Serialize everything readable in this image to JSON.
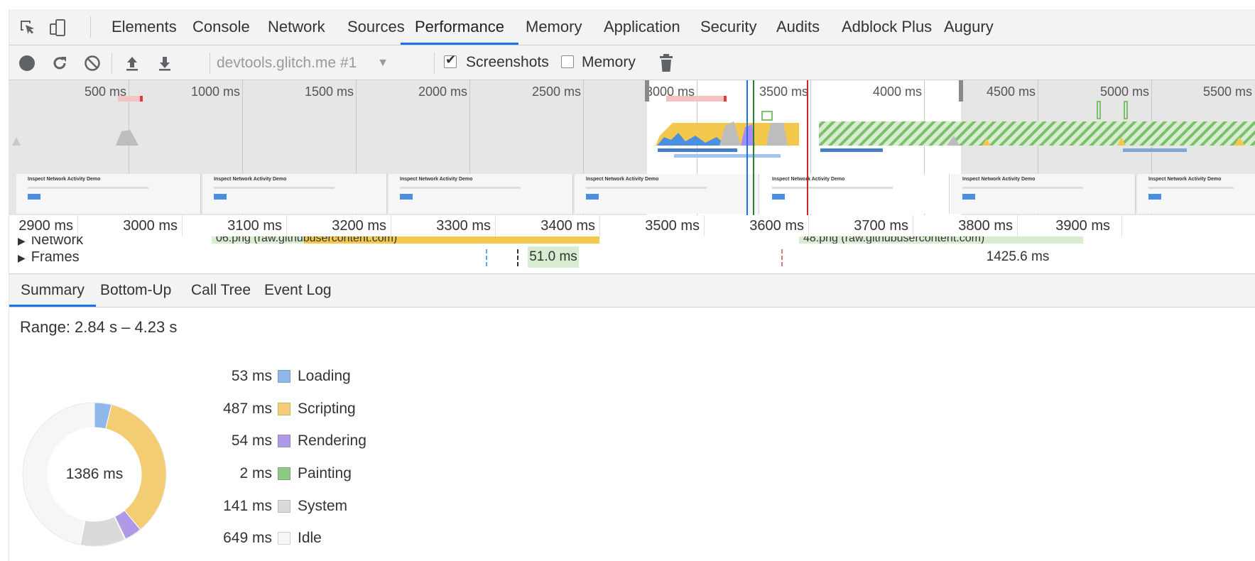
{
  "tabs": {
    "items": [
      {
        "label": "Elements"
      },
      {
        "label": "Console"
      },
      {
        "label": "Network"
      },
      {
        "label": "Sources"
      },
      {
        "label": "Performance",
        "active": true
      },
      {
        "label": "Memory"
      },
      {
        "label": "Application"
      },
      {
        "label": "Security"
      },
      {
        "label": "Audits"
      },
      {
        "label": "Adblock Plus"
      },
      {
        "label": "Augury"
      }
    ]
  },
  "toolbar": {
    "profile_select": "devtools.glitch.me #1",
    "screenshots_label": "Screenshots",
    "screenshots_checked": true,
    "memory_label": "Memory",
    "memory_checked": false
  },
  "overview": {
    "tick_labels": [
      "500 ms",
      "1000 ms",
      "1500 ms",
      "2000 ms",
      "2500 ms",
      "3000 ms",
      "3500 ms",
      "4000 ms",
      "4500 ms",
      "5000 ms",
      "5500 ms"
    ],
    "thumbnail_title": "Inspect Network Activity Demo"
  },
  "ruler": {
    "tick_labels": [
      "2900 ms",
      "3000 ms",
      "3100 ms",
      "3200 ms",
      "3300 ms",
      "3400 ms",
      "3500 ms",
      "3600 ms",
      "3700 ms",
      "3800 ms",
      "3900 ms"
    ]
  },
  "tracks": {
    "network_label": "Network",
    "frames_label": "Frames",
    "network_request_1": "06.png (raw.githubusercontent.com)",
    "network_request_2": "48.png (raw.githubusercontent.com)",
    "frame_1": "51.0 ms",
    "frame_2": "1425.6 ms"
  },
  "panel_tabs": {
    "items": [
      {
        "label": "Summary",
        "active": true
      },
      {
        "label": "Bottom-Up"
      },
      {
        "label": "Call Tree"
      },
      {
        "label": "Event Log"
      }
    ]
  },
  "summary": {
    "range": "Range: 2.84 s – 4.23 s",
    "total": "1386 ms",
    "categories": [
      {
        "value_text": "53 ms",
        "label": "Loading",
        "ms": 53,
        "color": "#8fb7ea"
      },
      {
        "value_text": "487 ms",
        "label": "Scripting",
        "ms": 487,
        "color": "#f2cd73"
      },
      {
        "value_text": "54 ms",
        "label": "Rendering",
        "ms": 54,
        "color": "#af9ae8"
      },
      {
        "value_text": "2 ms",
        "label": "Painting",
        "ms": 2,
        "color": "#8fc787"
      },
      {
        "value_text": "141 ms",
        "label": "System",
        "ms": 141,
        "color": "#dadada"
      },
      {
        "value_text": "649 ms",
        "label": "Idle",
        "ms": 649,
        "color": "#f6f6f6"
      }
    ]
  }
}
